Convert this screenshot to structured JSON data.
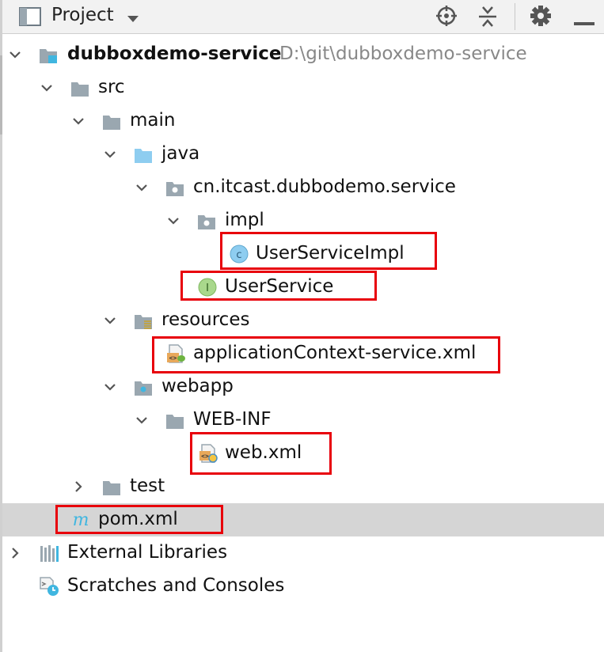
{
  "header": {
    "title": "Project",
    "icons": [
      "project-view-icon",
      "locate-target-icon",
      "collapse-all-icon",
      "settings-gear-icon",
      "hide-panel-icon"
    ]
  },
  "tree": {
    "module": {
      "name": "dubboxdemo-service",
      "path": "D:\\git\\dubboxdemo-service"
    },
    "src": "src",
    "main": "main",
    "java": "java",
    "package": "cn.itcast.dubbodemo.service",
    "impl": "impl",
    "user_service_impl": "UserServiceImpl",
    "user_service": "UserService",
    "resources": "resources",
    "app_context": "applicationContext-service.xml",
    "webapp": "webapp",
    "web_inf": "WEB-INF",
    "web_xml": "web.xml",
    "test": "test",
    "pom": "pom.xml",
    "external_libraries": "External Libraries",
    "scratches": "Scratches and Consoles"
  },
  "colors": {
    "highlight": "#e8000b",
    "folder": "#9aa7b0",
    "source_folder": "#8ecdf0",
    "selected_row": "#d5d5d5"
  }
}
